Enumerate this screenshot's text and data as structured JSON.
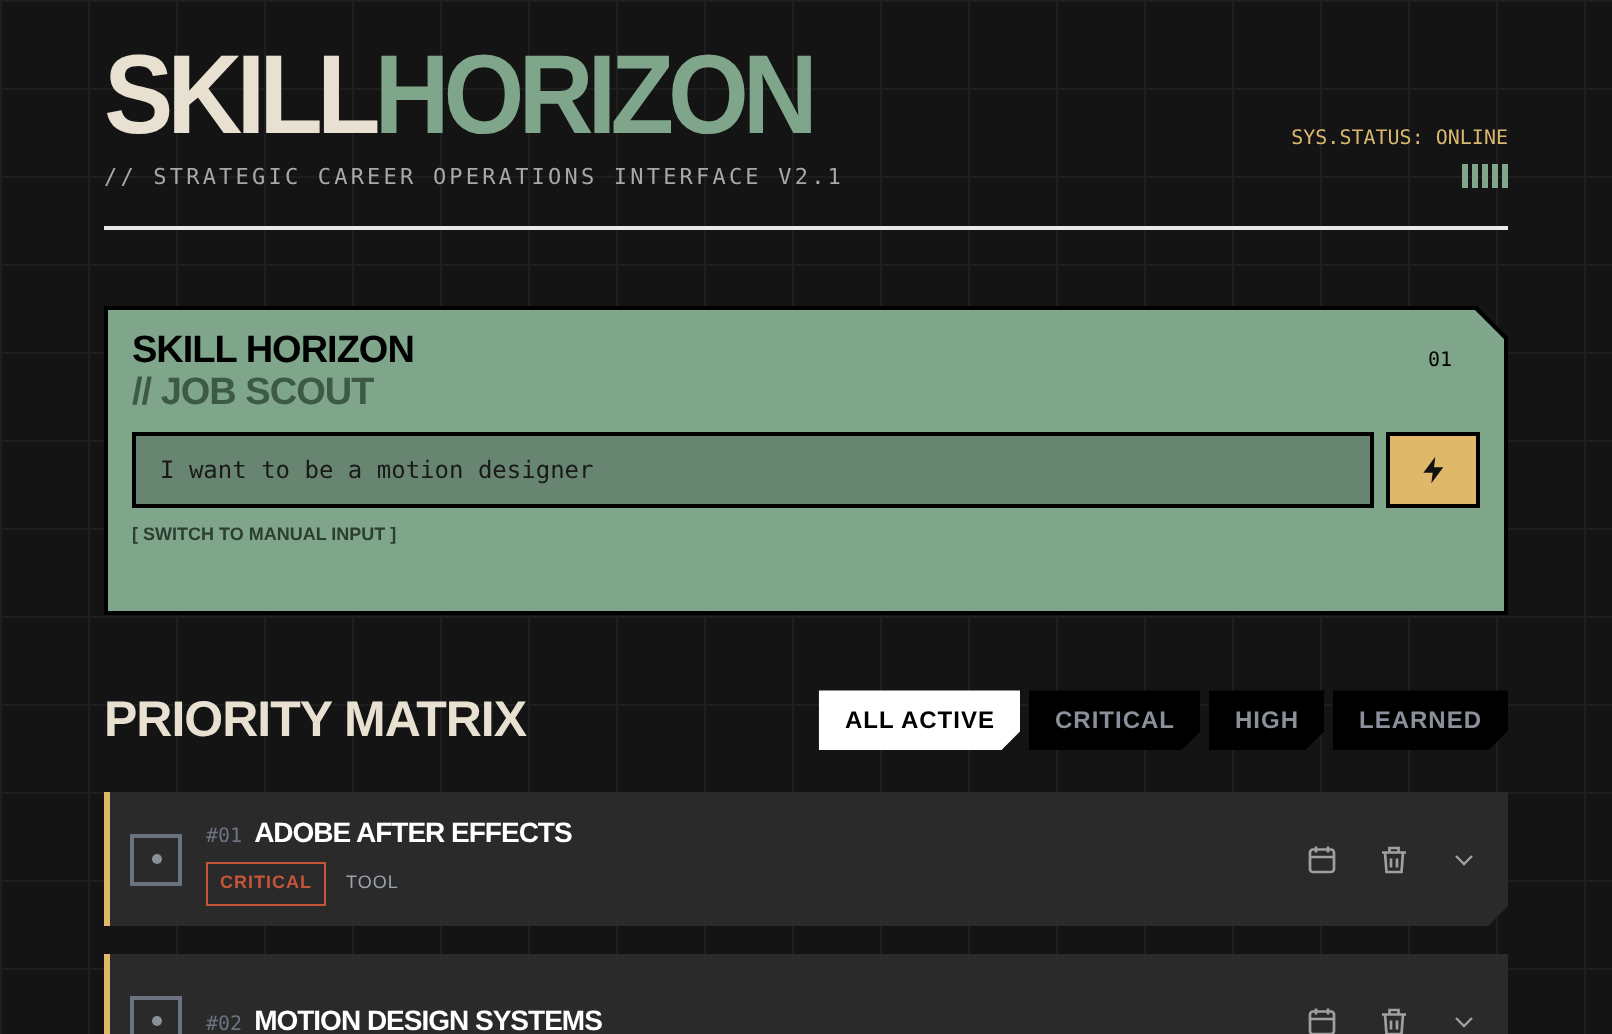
{
  "header": {
    "title_part_1": "SKILL",
    "title_part_2": "HORIZON",
    "subtitle": "// STRATEGIC CAREER OPERATIONS INTERFACE V2.1",
    "status": "SYS.STATUS: ONLINE"
  },
  "scout": {
    "title": "SKILL HORIZON",
    "subtitle": "// JOB SCOUT",
    "number": "01",
    "input_value": "I want to be a motion designer",
    "switch_link": "[ SWITCH TO MANUAL INPUT ]"
  },
  "matrix": {
    "title": "PRIORITY MATRIX",
    "tabs": [
      {
        "label": "ALL ACTIVE",
        "selected": true
      },
      {
        "label": "CRITICAL",
        "selected": false
      },
      {
        "label": "HIGH",
        "selected": false
      },
      {
        "label": "LEARNED",
        "selected": false
      }
    ],
    "items": [
      {
        "number": "#01",
        "name": "ADOBE AFTER EFFECTS",
        "tags": [
          {
            "kind": "priority",
            "label": "CRITICAL"
          },
          {
            "kind": "type",
            "label": "TOOL"
          }
        ]
      },
      {
        "number": "#02",
        "name": "MOTION DESIGN SYSTEMS"
      }
    ]
  }
}
